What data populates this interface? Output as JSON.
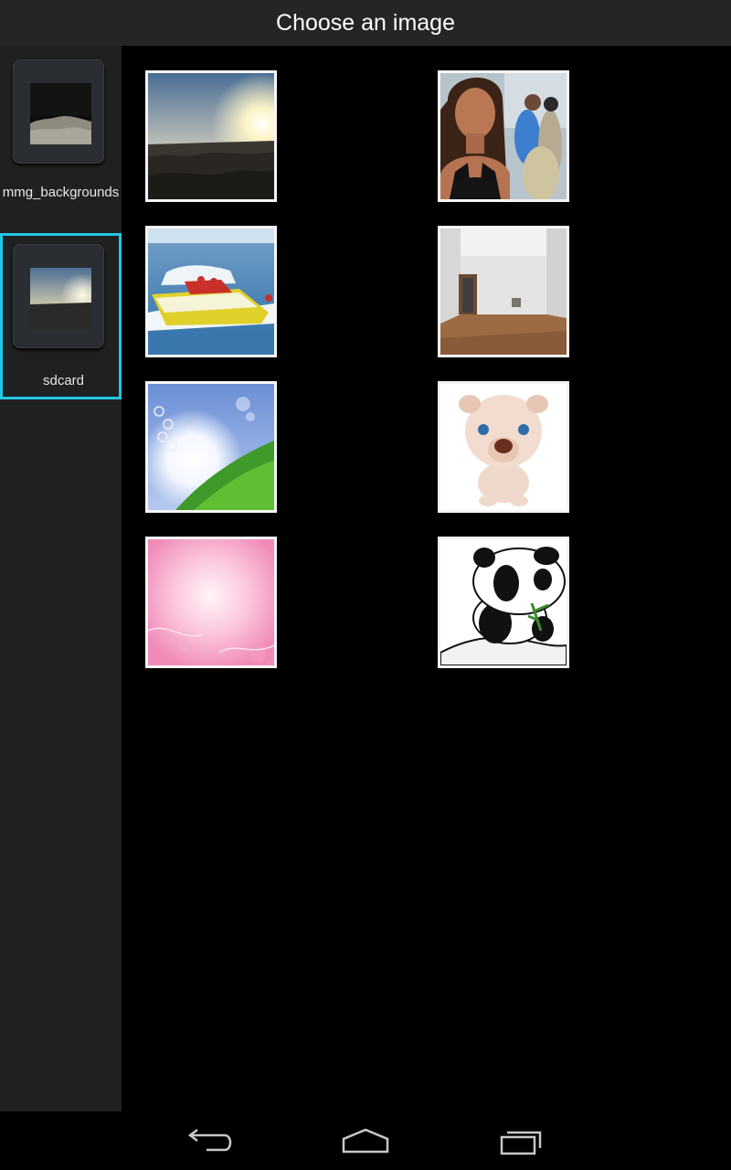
{
  "header": {
    "title": "Choose an image"
  },
  "sidebar": {
    "folders": [
      {
        "label": "mmg_backgrounds",
        "thumb": "rocky-ground-night"
      },
      {
        "label": "sdcard",
        "thumb": "sunset-crowd-beach",
        "selected": true
      }
    ]
  },
  "images": [
    {
      "name": "sunset-crowd-beach"
    },
    {
      "name": "woman-in-crowd"
    },
    {
      "name": "yellow-speedboat"
    },
    {
      "name": "empty-room"
    },
    {
      "name": "sky-grass-bubbles"
    },
    {
      "name": "cartoon-dog"
    },
    {
      "name": "pink-background"
    },
    {
      "name": "cartoon-panda"
    }
  ],
  "navbar": {
    "icons": [
      "back-icon",
      "home-icon",
      "recents-icon"
    ]
  },
  "colors": {
    "selection": "#21c7e6",
    "titlebar": "#252528",
    "sidebar": "#1f2021"
  }
}
